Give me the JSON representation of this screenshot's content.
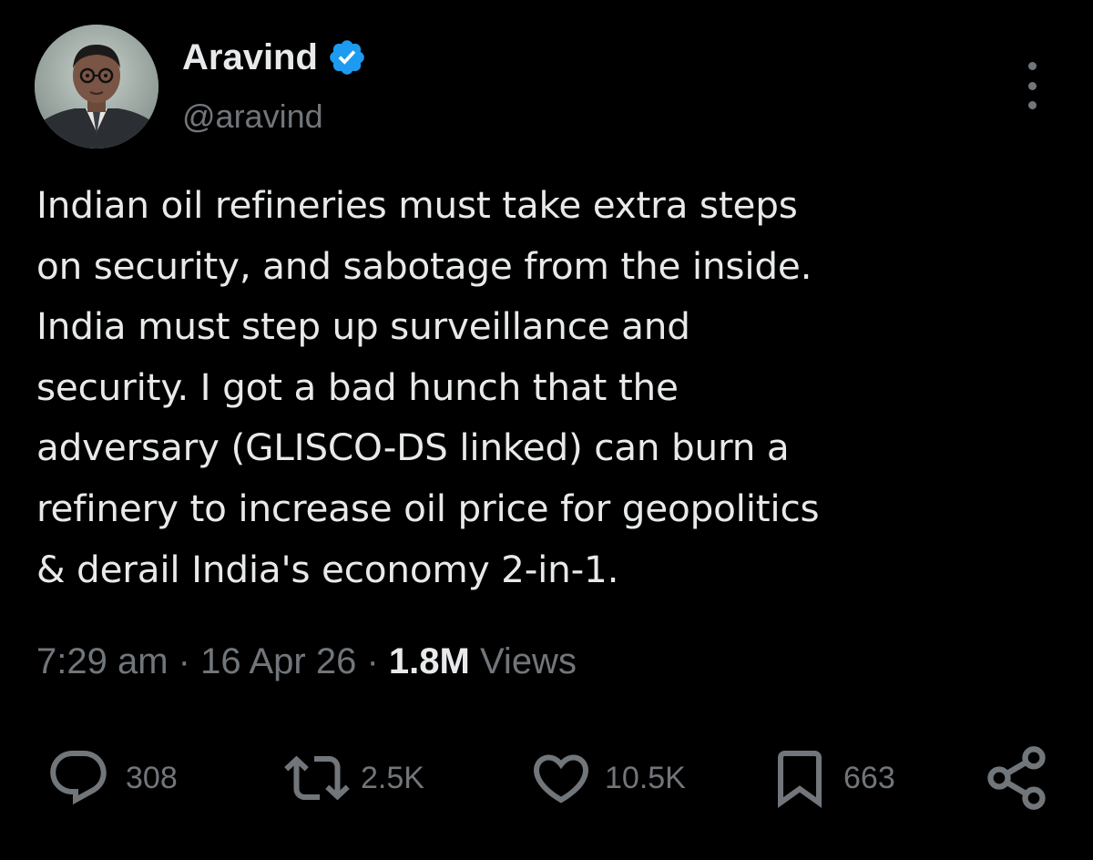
{
  "author": {
    "display_name": "Aravind",
    "handle": "@aravind",
    "verified": true,
    "avatar_icon": "portrait-avatar"
  },
  "more_icon": "more-vertical-icon",
  "tweet": {
    "text": "Indian oil refineries must take extra steps\non security, and sabotage from the inside.\nIndia must step up surveillance and\nsecurity. I got a bad hunch that the\nadversary (GLISCO-DS linked) can burn a\nrefinery to increase oil price for geopolitics\n& derail India's economy 2-in-1."
  },
  "meta": {
    "time": "7:29 am",
    "separator": "·",
    "date": "16 Apr 26",
    "views_count": "1.8M",
    "views_label": "Views"
  },
  "actions": {
    "replies": "308",
    "reposts": "2.5K",
    "likes": "10.5K",
    "bookmarks": "663"
  },
  "colors": {
    "background": "#000000",
    "primary_text": "#e7e9ea",
    "secondary_text": "#71767b",
    "verified_blue": "#1d9bf0"
  }
}
